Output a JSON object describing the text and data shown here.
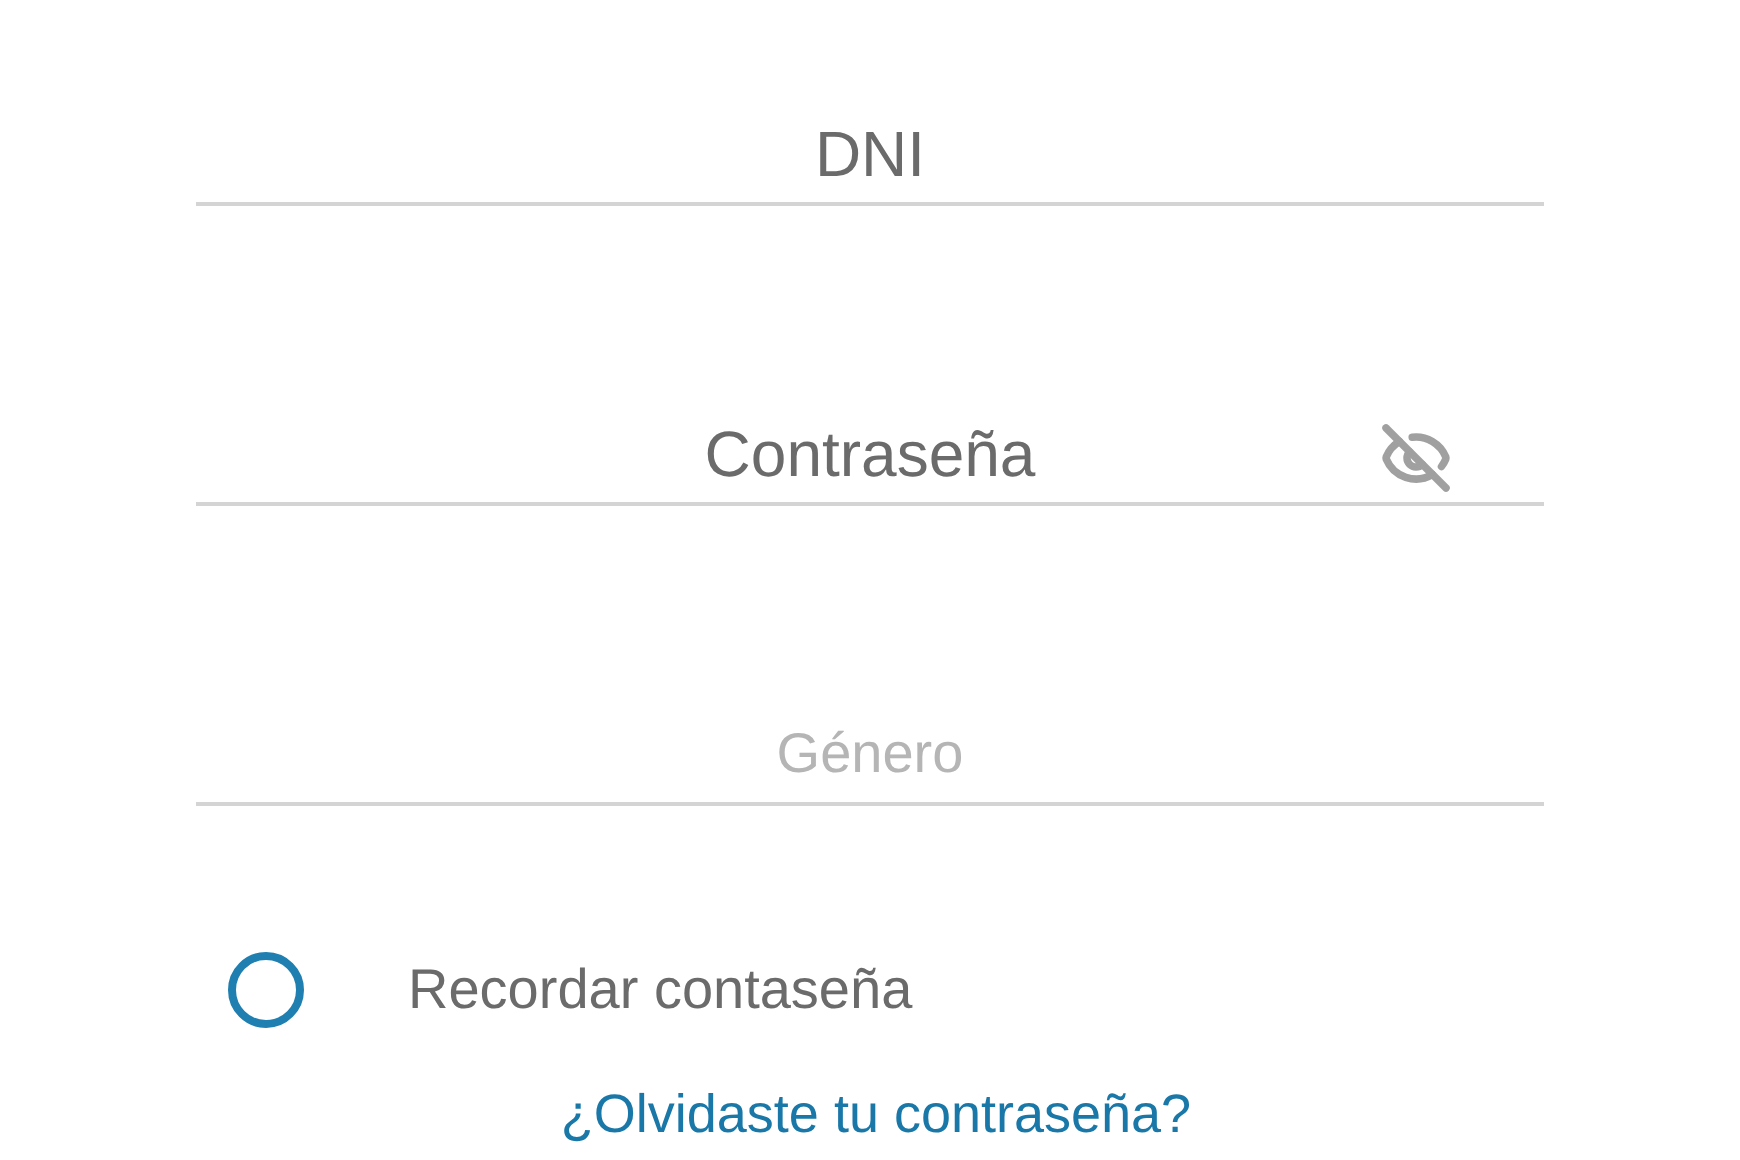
{
  "fields": [
    {
      "kind": "text",
      "placeholder": "DNI"
    },
    {
      "kind": "password",
      "placeholder": "Contraseña",
      "password_visible": false
    },
    {
      "kind": "select",
      "placeholder": "Género"
    }
  ],
  "remember": {
    "label": "Recordar contaseña",
    "checked": false
  },
  "forgot_link": "¿Olvidaste tu contraseña?"
}
